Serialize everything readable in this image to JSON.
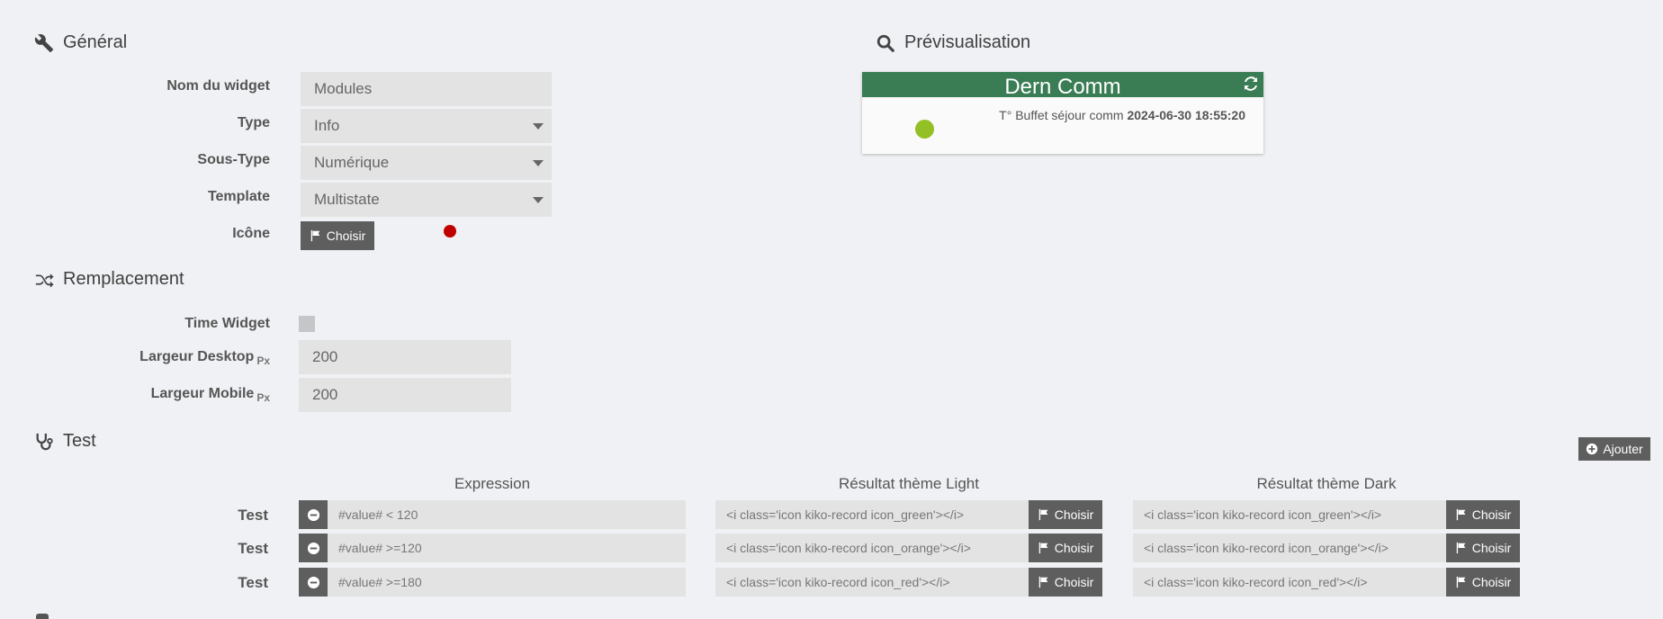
{
  "general": {
    "title": "Général",
    "fields": {
      "name": {
        "label": "Nom du widget",
        "value": "Modules"
      },
      "type": {
        "label": "Type",
        "value": "Info"
      },
      "subtype": {
        "label": "Sous-Type",
        "value": "Numérique"
      },
      "template": {
        "label": "Template",
        "value": "Multistate"
      },
      "icon": {
        "label": "Icône",
        "button": "Choisir"
      }
    },
    "icon_color": "#c00000"
  },
  "replacement": {
    "title": "Remplacement",
    "time_widget_label": "Time Widget",
    "desktop": {
      "label": "Largeur Desktop",
      "unit": "Px",
      "value": "200"
    },
    "mobile": {
      "label": "Largeur Mobile",
      "unit": "Px",
      "value": "200"
    }
  },
  "test": {
    "title": "Test",
    "add_button": "Ajouter",
    "columns": {
      "expression": "Expression",
      "light": "Résultat thème Light",
      "dark": "Résultat thème Dark"
    },
    "choose_label": "Choisir",
    "rows": [
      {
        "label": "Test",
        "expression": "#value# < 120",
        "light": "<i class='icon kiko-record icon_green'></i>",
        "dark": "<i class='icon kiko-record icon_green'></i>"
      },
      {
        "label": "Test",
        "expression": "#value# >=120",
        "light": "<i class='icon kiko-record icon_orange'></i>",
        "dark": "<i class='icon kiko-record icon_orange'></i>"
      },
      {
        "label": "Test",
        "expression": "#value# >=180",
        "light": "<i class='icon kiko-record icon_red'></i>",
        "dark": "<i class='icon kiko-record icon_red'></i>"
      }
    ]
  },
  "preview": {
    "title": "Prévisualisation",
    "widget_name": "Dern Comm",
    "info_label": "T° Buffet séjour comm",
    "timestamp": "2024-06-30 18:55:20",
    "header_color": "#3a7d55",
    "dot_color": "#93c024"
  }
}
